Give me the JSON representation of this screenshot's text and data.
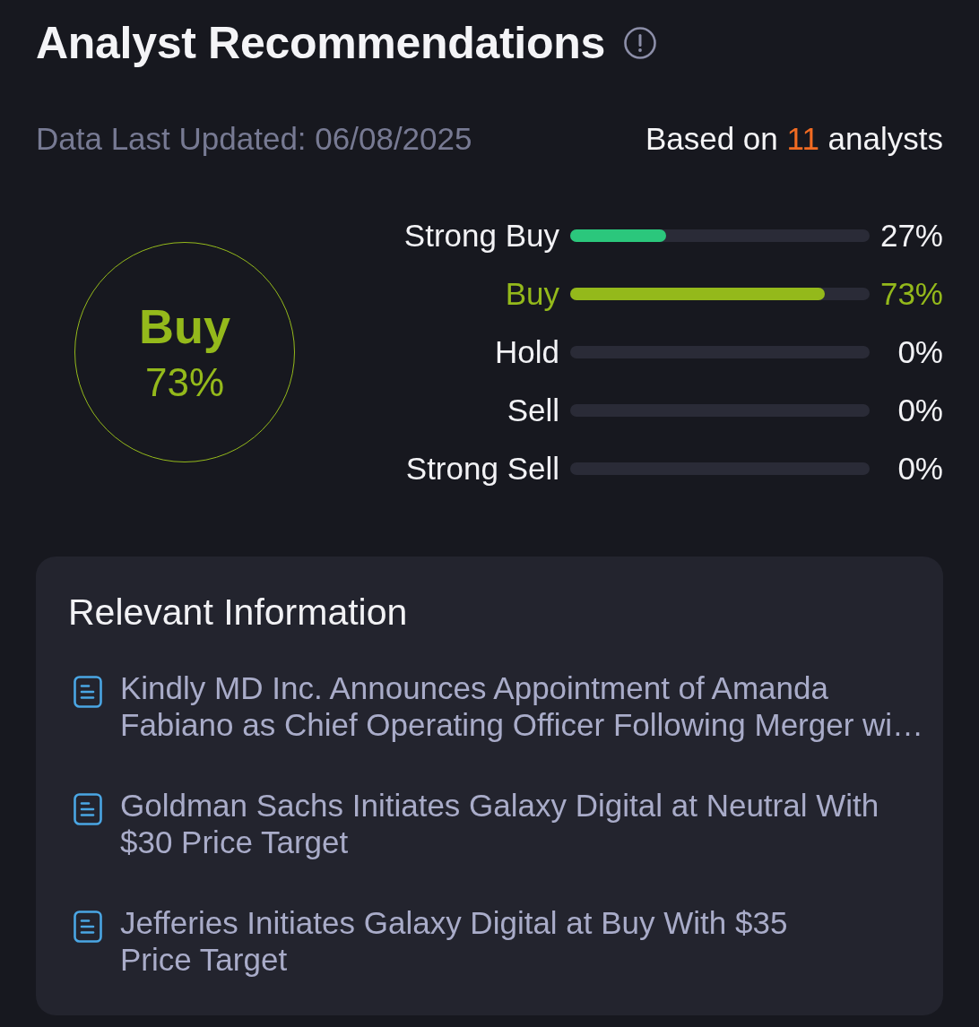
{
  "header": {
    "title": "Analyst Recommendations"
  },
  "meta": {
    "updated": "Data Last Updated: 06/08/2025",
    "based_on": {
      "prefix": "Based on",
      "count": "11",
      "suffix": "analysts"
    }
  },
  "consensus": {
    "label": "Buy",
    "percent": "73%"
  },
  "ratings": [
    {
      "label": "Strong Buy",
      "level": 0.32,
      "percent": "27%",
      "color": "#2bc77c",
      "selected": false
    },
    {
      "label": "Buy",
      "level": 0.85,
      "percent": "73%",
      "color": "#94b91b",
      "selected": true
    },
    {
      "label": "Hold",
      "percent": "0%",
      "selected": false
    },
    {
      "label": "Sell",
      "percent": "0%",
      "selected": false
    },
    {
      "label": "Strong Sell",
      "percent": "0%",
      "selected": false
    }
  ],
  "relevant_information": {
    "title": "Relevant Information",
    "items": [
      {
        "headline": "Kindly MD Inc. Announces Appointment of Amanda Fabiano as Chief Operating Officer Following Merger wi…"
      },
      {
        "headline": "Goldman Sachs Initiates Galaxy Digital at Neutral With $30 Price Target"
      },
      {
        "headline": "Jefferies Initiates Galaxy Digital at Buy With $35 Price Target"
      }
    ]
  }
}
